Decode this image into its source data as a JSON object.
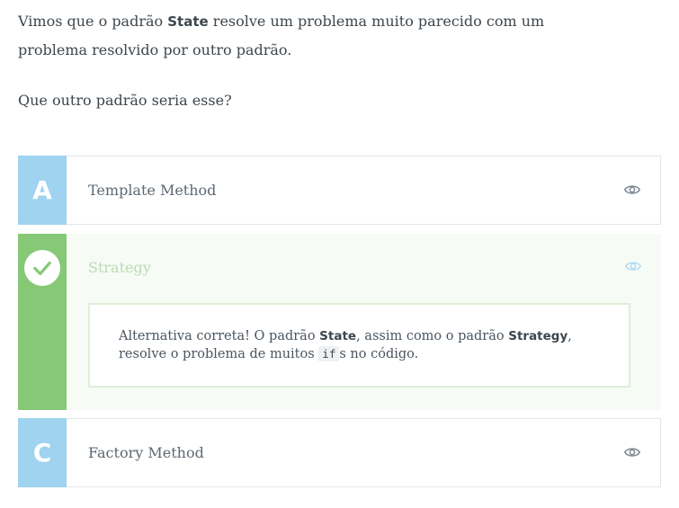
{
  "question": {
    "line1_pre": "Vimos que o padrão ",
    "line1_bold": "State",
    "line1_post": " resolve um problema muito parecido com um",
    "line2": "problema resolvido por outro padrão.",
    "line3": "Que outro padrão seria esse?"
  },
  "alternatives": [
    {
      "letter": "A",
      "label": "Template Method",
      "icon": "eye-icon"
    },
    {
      "letter": "",
      "label": "Strategy",
      "icon": "eye-icon",
      "status": "correct",
      "explanation": {
        "t1": "Alternativa correta! O padrão ",
        "b1": "State",
        "t2": ", assim como o padrão ",
        "b2": "Strategy",
        "t3": ", resolve o problema de muitos ",
        "code": "if",
        "t4": "s no código."
      }
    },
    {
      "letter": "C",
      "label": "Factory Method",
      "icon": "eye-icon"
    }
  ],
  "colors": {
    "letter_bg": "#9fd3ef",
    "correct_bg": "#86c876",
    "correct_panel": "#f6fbf6"
  }
}
